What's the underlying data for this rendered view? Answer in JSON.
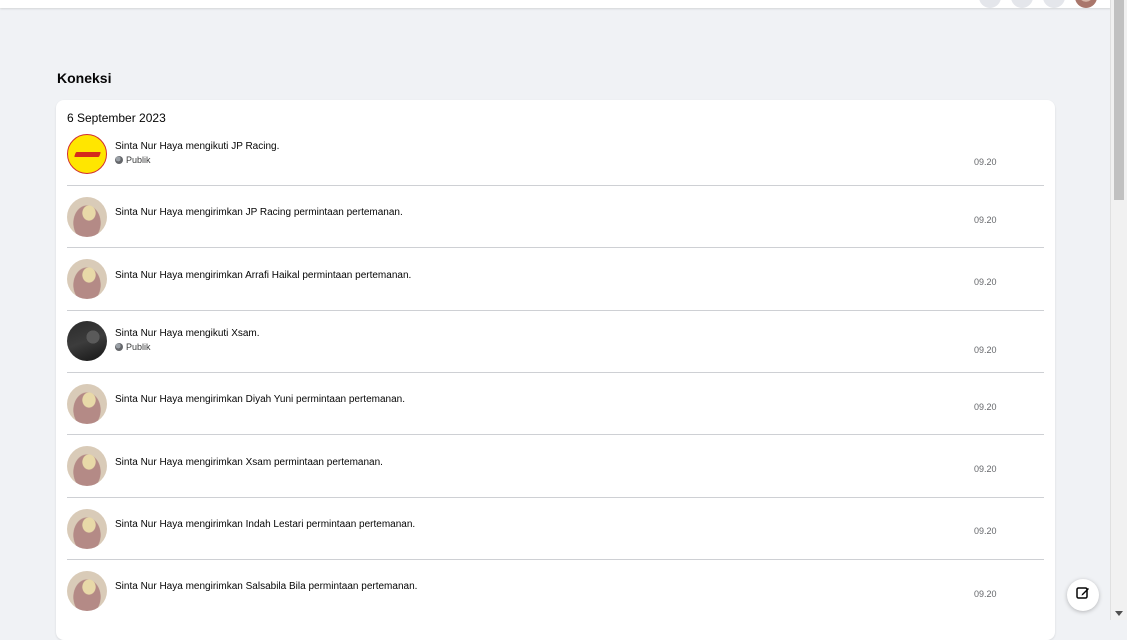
{
  "section_title": "Koneksi",
  "date_header": "6 September 2023",
  "items": [
    {
      "avatar": "jp-racing-logo",
      "actor": "Sinta Nur Haya",
      "verb": "mengikuti",
      "target": "JP Racing",
      "suffix": ".",
      "audience": "Publik",
      "time": "09.20"
    },
    {
      "avatar": "sinta-avatar",
      "actor": "Sinta Nur Haya",
      "verb": "mengirimkan",
      "target": "JP Racing",
      "suffix": "permintaan pertemanan.",
      "audience": "",
      "time": "09.20"
    },
    {
      "avatar": "sinta-avatar",
      "actor": "Sinta Nur Haya",
      "verb": "mengirimkan",
      "target": "Arrafi Haikal",
      "suffix": "permintaan pertemanan.",
      "audience": "",
      "time": "09.20"
    },
    {
      "avatar": "xsam-avatar",
      "actor": "Sinta Nur Haya",
      "verb": "mengikuti",
      "target": "Xsam",
      "suffix": ".",
      "audience": "Publik",
      "time": "09.20"
    },
    {
      "avatar": "sinta-avatar",
      "actor": "Sinta Nur Haya",
      "verb": "mengirimkan",
      "target": "Diyah Yuni",
      "suffix": "permintaan pertemanan.",
      "audience": "",
      "time": "09.20"
    },
    {
      "avatar": "sinta-avatar",
      "actor": "Sinta Nur Haya",
      "verb": "mengirimkan",
      "target": "Xsam",
      "suffix": "permintaan pertemanan.",
      "audience": "",
      "time": "09.20"
    },
    {
      "avatar": "sinta-avatar",
      "actor": "Sinta Nur Haya",
      "verb": "mengirimkan",
      "target": "Indah Lestari",
      "suffix": "permintaan pertemanan.",
      "audience": "",
      "time": "09.20"
    },
    {
      "avatar": "sinta-avatar",
      "actor": "Sinta Nur Haya",
      "verb": "mengirimkan",
      "target": "Salsabila Bila",
      "suffix": "permintaan pertemanan.",
      "audience": "",
      "time": "09.20"
    }
  ],
  "compose_icon": "edit-icon"
}
